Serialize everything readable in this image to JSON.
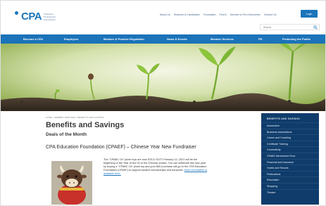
{
  "header": {
    "logo_text": "CPA",
    "logo_sub": [
      "Chartered",
      "Professional",
      "Accountants"
    ],
    "top_links": [
      "About Us",
      "Students & Candidates",
      "Foundation",
      "Find A",
      "Member & Firm Directories",
      "Contact Us"
    ],
    "login_label": "Login",
    "search_placeholder": "Search"
  },
  "main_nav": [
    "Become a CPA",
    "Employers",
    "Member & Practice Regulation",
    "News & Events",
    "Member Services",
    "PD",
    "Protecting the Public"
  ],
  "content": {
    "breadcrumb": "HOME / MEMBER SERVICES / BENEFITS AND SAVINGS",
    "page_title": "Benefits and Savings",
    "subtitle": "Deals of the Month",
    "article_title": "CPA Education Foundation (CPAEF) – Chinese Year New Fundraiser",
    "article_body": "The \"CPABC Ox\" plush toys are now SOLD OUT! February 12, 2021 will be the beginning of the Year of the Ox in the Chinese zodiac. You can celebrate this new year by buying a \"CPABC Ox\" plush toy and your $40 purchase will go to the CPA Education Foundation (CPAEF) to support student scholarships and bursaries.",
    "more_link": "More information is available here."
  },
  "sidebar": {
    "title": "BENEFITS AND SAVINGS",
    "items": [
      "Automotive",
      "Business Associations",
      "Career and Coaching",
      "Certificate Training",
      "Connectivity",
      "CPABC Benevolent Fund",
      "Financial and Insurance",
      "Hotels and Resorts",
      "Publications",
      "Recreation",
      "Shopping",
      "Theatre"
    ]
  },
  "colors": {
    "brand_blue": "#1b73b9",
    "sidebar_navy": "#0f3c6b"
  }
}
